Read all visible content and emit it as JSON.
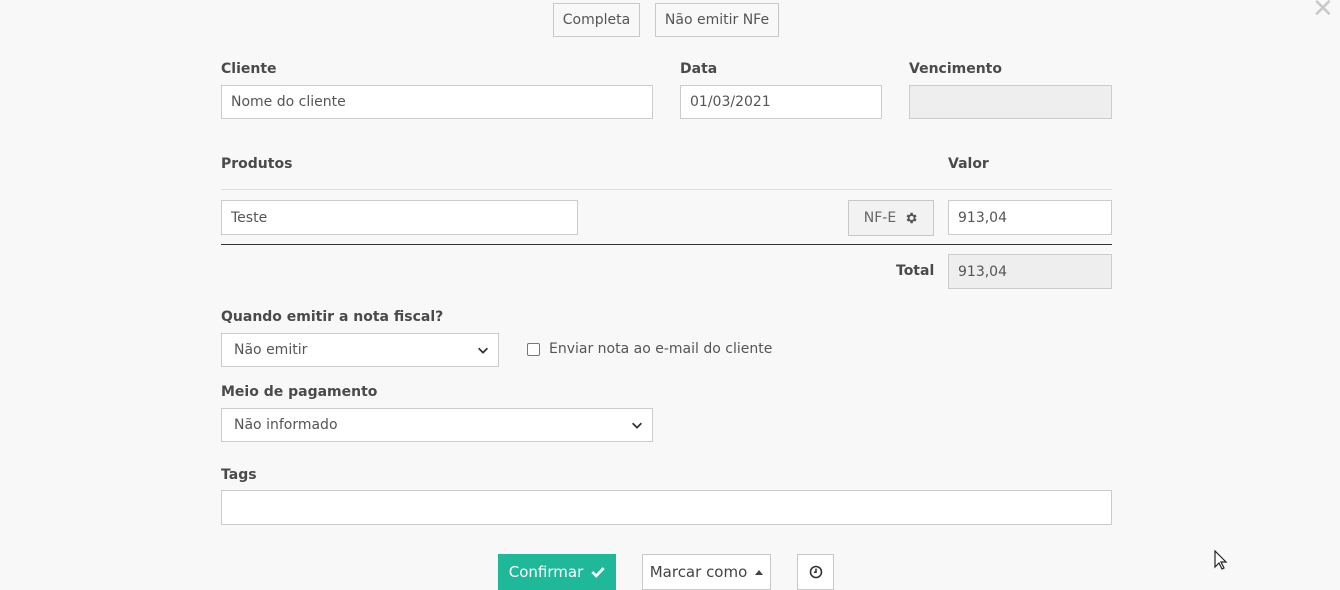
{
  "top_buttons": {
    "completa": "Completa",
    "nao_emitir": "Não emitir NFe"
  },
  "cliente": {
    "label": "Cliente",
    "value": "Nome do cliente"
  },
  "data": {
    "label": "Data",
    "value": "01/03/2021"
  },
  "vencimento": {
    "label": "Vencimento",
    "value": ""
  },
  "produtos": {
    "label": "Produtos",
    "valor_label": "Valor",
    "items": [
      {
        "name": "Teste",
        "nfe_label": "NF-E",
        "valor": "913,04"
      }
    ],
    "total_label": "Total",
    "total_value": "913,04"
  },
  "nota": {
    "label": "Quando emitir a nota fiscal?",
    "selected": "Não emitir",
    "email_checkbox_label": "Enviar nota ao e-mail do cliente"
  },
  "pagamento": {
    "label": "Meio de pagamento",
    "selected": "Não informado"
  },
  "tags": {
    "label": "Tags",
    "value": ""
  },
  "actions": {
    "confirmar": "Confirmar",
    "marcar_como": "Marcar como"
  },
  "colors": {
    "accent": "#1fb99a"
  }
}
